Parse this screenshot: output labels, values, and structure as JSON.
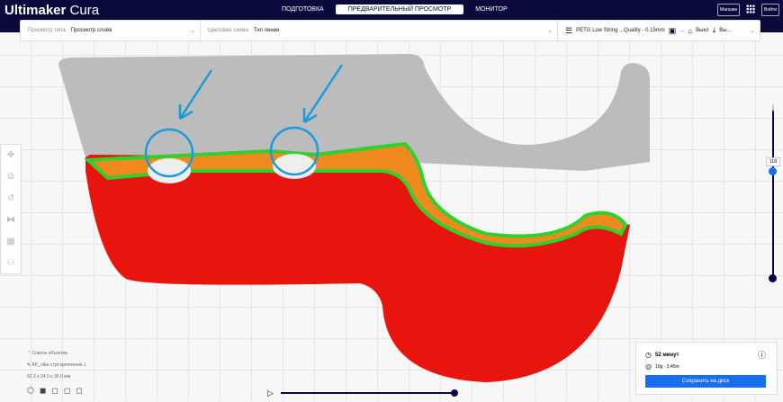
{
  "header": {
    "logo_bold": "Ultimaker",
    "logo_light": " Cura",
    "tabs": [
      {
        "label": "ПОДГОТОВКА"
      },
      {
        "label": "ПРЕДВАРИТЕЛЬНЫЙ ПРОСМОТР"
      },
      {
        "label": "МОНИТОР"
      }
    ],
    "marketplace": "Магазин",
    "signin": "Войти"
  },
  "toolbar": {
    "view_type_label": "Просмотр типа",
    "view_type_value": "Просмотр слоёв",
    "color_scheme_label": "Цветовая схема",
    "color_scheme_value": "Тип линии",
    "profile": "PETG Low String ...Quality - 0.15mm",
    "support_value": "...",
    "adhesion_value": "Выкл",
    "extra_value": "Вы..."
  },
  "objects": {
    "header": "Список объектов",
    "name": "KK_nika ступ крепление 1",
    "dimensions": "62.3 x 24.0 x 30.0 мм"
  },
  "layer_slider": {
    "current_layer": "118"
  },
  "playback": {
    "progress": 1.0
  },
  "print_info": {
    "time": "52 минут",
    "material": "10g · 3.45m",
    "save_label": "Сохранить на диск"
  },
  "colors": {
    "header": "#0a0b3c",
    "accent": "#196ef0",
    "wall": "#e8150f",
    "infill": "#f08a1e",
    "skin": "#2fd12f",
    "annotation": "#1a9be0"
  }
}
